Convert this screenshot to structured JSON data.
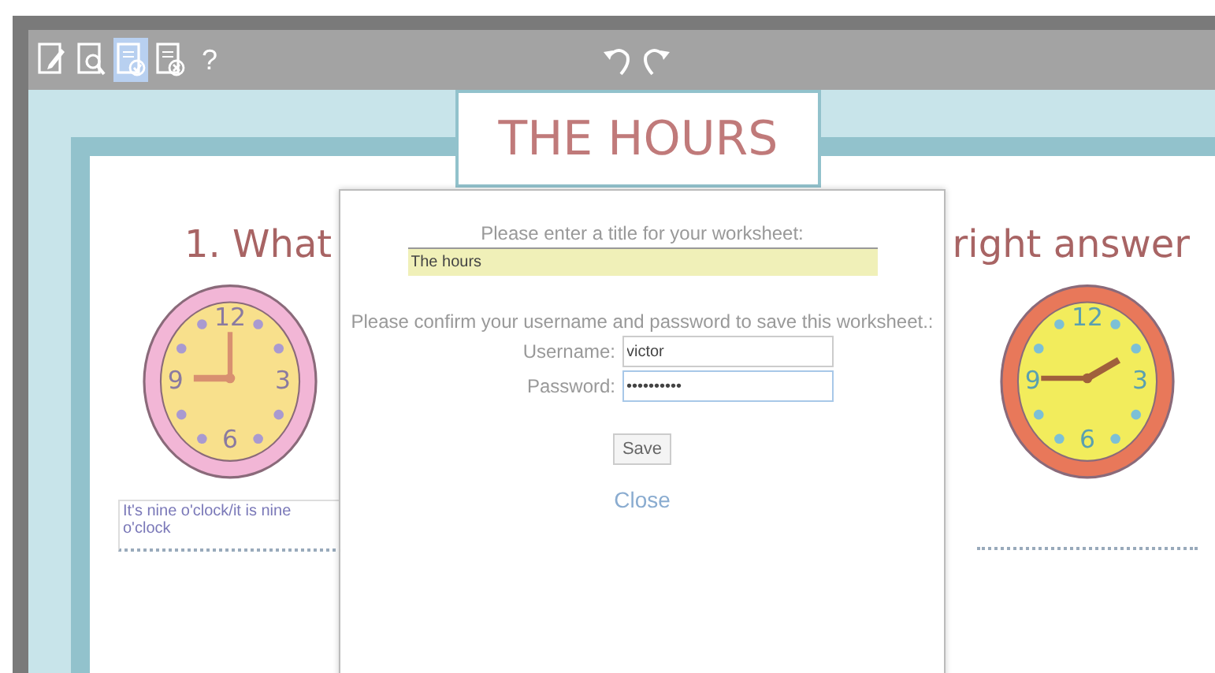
{
  "toolbar": {
    "tools": [
      {
        "kind": "edit",
        "selected": false
      },
      {
        "kind": "preview",
        "selected": false
      },
      {
        "kind": "save",
        "selected": true
      },
      {
        "kind": "delete",
        "selected": false
      },
      {
        "kind": "help",
        "label": "?",
        "selected": false
      }
    ],
    "history": [
      {
        "kind": "undo"
      },
      {
        "kind": "redo"
      }
    ]
  },
  "worksheet": {
    "title": "THE HOURS",
    "question_start": "1. What",
    "question_end": "right answer",
    "clocks": [
      {
        "numerals": [
          "12",
          "3",
          "6",
          "9"
        ],
        "answer": "It's nine o'clock/it is nine o'clock"
      },
      {
        "numerals": [
          "12",
          "3",
          "6",
          "9"
        ]
      }
    ]
  },
  "dialog": {
    "title_prompt": "Please enter a title for your worksheet:",
    "title_value": "The hours",
    "confirm_prompt": "Please confirm your username and password to save this worksheet.:",
    "username_label": "Username:",
    "username_value": "victor",
    "password_label": "Password:",
    "password_value": "••••••••••",
    "save_button": "Save",
    "close_link": "Close"
  }
}
